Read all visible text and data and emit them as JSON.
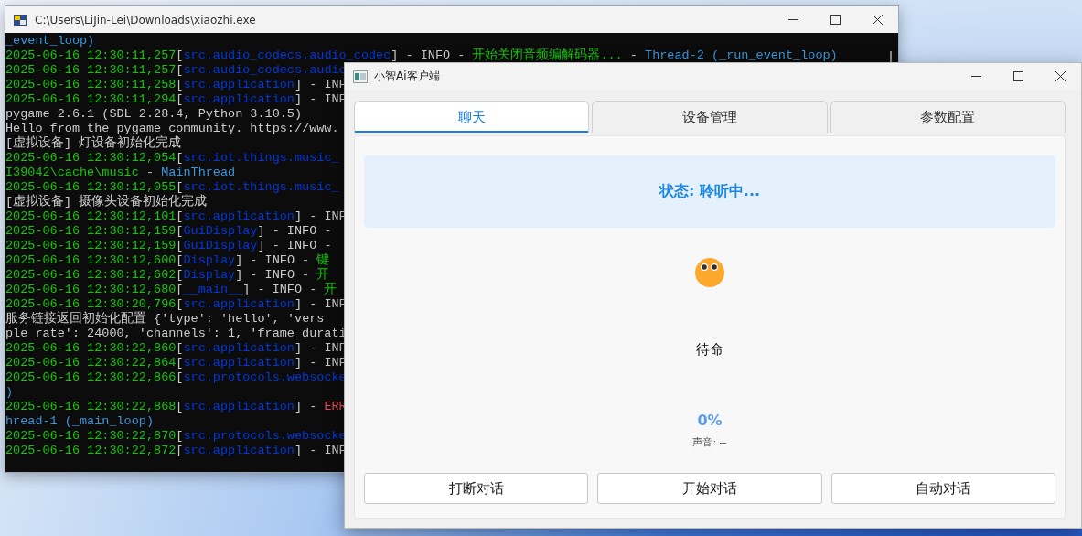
{
  "console_window": {
    "title": "C:\\Users\\LiJin-Lei\\Downloads\\xiaozhi.exe",
    "lines": [
      {
        "segments": [
          {
            "kind": "thread",
            "text": "_event_loop)"
          }
        ]
      },
      {
        "segments": [
          {
            "kind": "time",
            "text": "2025-06-16 12:30:11,257"
          },
          {
            "kind": "plain",
            "text": "["
          },
          {
            "kind": "module",
            "text": "src.audio_codecs.audio_codec"
          },
          {
            "kind": "plain",
            "text": "] - INFO - "
          },
          {
            "kind": "message",
            "text": "开始关闭音频编解码器..."
          },
          {
            "kind": "plain",
            "text": " - "
          },
          {
            "kind": "thread",
            "text": "Thread-2 (_run_event_loop)"
          }
        ]
      },
      {
        "segments": [
          {
            "kind": "time",
            "text": "2025-06-16 12:30:11,257"
          },
          {
            "kind": "plain",
            "text": "["
          },
          {
            "kind": "module",
            "text": "src.audio_codecs.audio"
          }
        ]
      },
      {
        "segments": [
          {
            "kind": "time",
            "text": "2025-06-16 12:30:11,258"
          },
          {
            "kind": "plain",
            "text": "["
          },
          {
            "kind": "module",
            "text": "src.application"
          },
          {
            "kind": "plain",
            "text": "] - INF"
          }
        ]
      },
      {
        "segments": [
          {
            "kind": "time",
            "text": "2025-06-16 12:30:11,294"
          },
          {
            "kind": "plain",
            "text": "["
          },
          {
            "kind": "module",
            "text": "src.application"
          },
          {
            "kind": "plain",
            "text": "] - INF"
          }
        ]
      },
      {
        "segments": [
          {
            "kind": "plain",
            "text": "pygame 2.6.1 (SDL 2.28.4, Python 3.10.5)"
          }
        ]
      },
      {
        "segments": [
          {
            "kind": "plain",
            "text": "Hello from the pygame community. https://www."
          }
        ]
      },
      {
        "segments": [
          {
            "kind": "plain",
            "text": "[虚拟设备] 灯设备初始化完成"
          }
        ]
      },
      {
        "segments": [
          {
            "kind": "time",
            "text": "2025-06-16 12:30:12,054"
          },
          {
            "kind": "plain",
            "text": "["
          },
          {
            "kind": "module",
            "text": "src.iot.things.music_"
          }
        ]
      },
      {
        "segments": [
          {
            "kind": "message",
            "text": "I39042\\cache\\music"
          },
          {
            "kind": "plain",
            "text": " - "
          },
          {
            "kind": "thread",
            "text": "MainThread"
          }
        ]
      },
      {
        "segments": [
          {
            "kind": "time",
            "text": "2025-06-16 12:30:12,055"
          },
          {
            "kind": "plain",
            "text": "["
          },
          {
            "kind": "module",
            "text": "src.iot.things.music_"
          }
        ]
      },
      {
        "segments": [
          {
            "kind": "plain",
            "text": "[虚拟设备] 摄像头设备初始化完成"
          }
        ]
      },
      {
        "segments": [
          {
            "kind": "time",
            "text": "2025-06-16 12:30:12,101"
          },
          {
            "kind": "plain",
            "text": "["
          },
          {
            "kind": "module",
            "text": "src.application"
          },
          {
            "kind": "plain",
            "text": "] - INF"
          }
        ]
      },
      {
        "segments": [
          {
            "kind": "time",
            "text": "2025-06-16 12:30:12,159"
          },
          {
            "kind": "plain",
            "text": "["
          },
          {
            "kind": "module",
            "text": "GuiDisplay"
          },
          {
            "kind": "plain",
            "text": "] - INFO - "
          }
        ]
      },
      {
        "segments": [
          {
            "kind": "time",
            "text": "2025-06-16 12:30:12,159"
          },
          {
            "kind": "plain",
            "text": "["
          },
          {
            "kind": "module",
            "text": "GuiDisplay"
          },
          {
            "kind": "plain",
            "text": "] - INFO - "
          }
        ]
      },
      {
        "segments": [
          {
            "kind": "time",
            "text": "2025-06-16 12:30:12,600"
          },
          {
            "kind": "plain",
            "text": "["
          },
          {
            "kind": "module",
            "text": "Display"
          },
          {
            "kind": "plain",
            "text": "] - INFO - "
          },
          {
            "kind": "message",
            "text": "键"
          }
        ]
      },
      {
        "segments": [
          {
            "kind": "time",
            "text": "2025-06-16 12:30:12,602"
          },
          {
            "kind": "plain",
            "text": "["
          },
          {
            "kind": "module",
            "text": "Display"
          },
          {
            "kind": "plain",
            "text": "] - INFO - "
          },
          {
            "kind": "message",
            "text": "开"
          }
        ]
      },
      {
        "segments": [
          {
            "kind": "time",
            "text": "2025-06-16 12:30:12,680"
          },
          {
            "kind": "plain",
            "text": "["
          },
          {
            "kind": "module",
            "text": "__main__"
          },
          {
            "kind": "plain",
            "text": "] - INFO - "
          },
          {
            "kind": "message",
            "text": "开"
          }
        ]
      },
      {
        "segments": [
          {
            "kind": "time",
            "text": "2025-06-16 12:30:20,796"
          },
          {
            "kind": "plain",
            "text": "["
          },
          {
            "kind": "module",
            "text": "src.application"
          },
          {
            "kind": "plain",
            "text": "] - INF"
          }
        ]
      },
      {
        "segments": [
          {
            "kind": "plain",
            "text": "服务链接返回初始化配置 {'type': 'hello', 'vers"
          }
        ]
      },
      {
        "segments": [
          {
            "kind": "plain",
            "text": "ple_rate': 24000, 'channels': 1, 'frame_durati"
          }
        ]
      },
      {
        "segments": [
          {
            "kind": "time",
            "text": "2025-06-16 12:30:22,860"
          },
          {
            "kind": "plain",
            "text": "["
          },
          {
            "kind": "module",
            "text": "src.application"
          },
          {
            "kind": "plain",
            "text": "] - INF"
          }
        ]
      },
      {
        "segments": [
          {
            "kind": "time",
            "text": "2025-06-16 12:30:22,864"
          },
          {
            "kind": "plain",
            "text": "["
          },
          {
            "kind": "module",
            "text": "src.application"
          },
          {
            "kind": "plain",
            "text": "] - INF"
          }
        ]
      },
      {
        "segments": [
          {
            "kind": "time",
            "text": "2025-06-16 12:30:22,866"
          },
          {
            "kind": "plain",
            "text": "["
          },
          {
            "kind": "module",
            "text": "src.protocols.websocke"
          }
        ]
      },
      {
        "segments": [
          {
            "kind": "thread",
            "text": ")"
          }
        ]
      },
      {
        "segments": [
          {
            "kind": "time",
            "text": "2025-06-16 12:30:22,868"
          },
          {
            "kind": "plain",
            "text": "["
          },
          {
            "kind": "module",
            "text": "src.application"
          },
          {
            "kind": "plain",
            "text": "] - "
          },
          {
            "kind": "error",
            "text": "ERR"
          }
        ]
      },
      {
        "segments": [
          {
            "kind": "thread",
            "text": "hread-1 (_main_loop)"
          }
        ]
      },
      {
        "segments": [
          {
            "kind": "time",
            "text": "2025-06-16 12:30:22,870"
          },
          {
            "kind": "plain",
            "text": "["
          },
          {
            "kind": "module",
            "text": "src.protocols.websocke"
          }
        ]
      },
      {
        "segments": [
          {
            "kind": "time",
            "text": "2025-06-16 12:30:22,872"
          },
          {
            "kind": "plain",
            "text": "["
          },
          {
            "kind": "module",
            "text": "src.application"
          },
          {
            "kind": "plain",
            "text": "] - INF"
          }
        ]
      }
    ]
  },
  "app_window": {
    "title": "小智Ai客户端",
    "tabs": [
      {
        "label": "聊天",
        "selected": true
      },
      {
        "label": "设备管理",
        "selected": false
      },
      {
        "label": "参数配置",
        "selected": false
      }
    ],
    "status": "状态: 聆听中...",
    "emotion_text": "待命",
    "volume_percent": "0%",
    "volume_label": "声音: --",
    "buttons": [
      "打断对话",
      "开始对话",
      "自动对话"
    ]
  }
}
